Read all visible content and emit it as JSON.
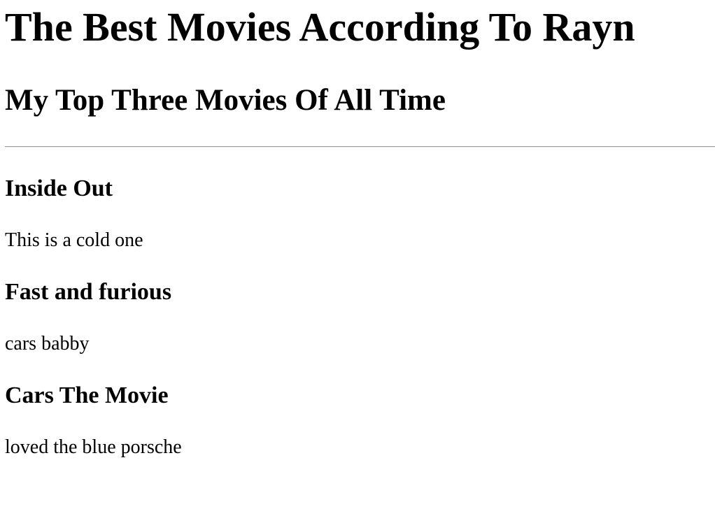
{
  "page": {
    "title": "The Best Movies According To Rayn",
    "subtitle": "My Top Three Movies Of All Time"
  },
  "movies": [
    {
      "title": "Inside Out",
      "description": "This is a cold one"
    },
    {
      "title": "Fast and furious",
      "description": "cars babby"
    },
    {
      "title": "Cars The Movie",
      "description": "loved the blue porsche"
    }
  ]
}
